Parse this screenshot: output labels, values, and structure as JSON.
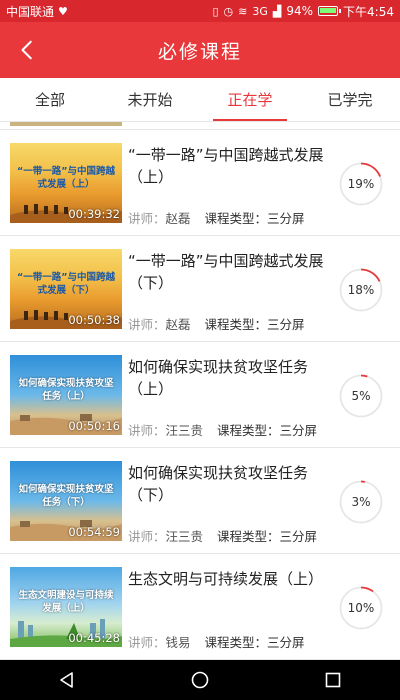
{
  "status_bar": {
    "carrier": "中国联通",
    "signal_label": "3G",
    "battery_text": "94%",
    "battery_level": 0.94,
    "time": "下午4:54"
  },
  "header": {
    "title": "必修课程"
  },
  "tabs": [
    {
      "label": "全部",
      "active": false
    },
    {
      "label": "未开始",
      "active": false
    },
    {
      "label": "正在学",
      "active": true
    },
    {
      "label": "已学完",
      "active": false
    }
  ],
  "labels": {
    "teacher_prefix": "讲师：",
    "type_prefix": "课程类型："
  },
  "courses": [
    {
      "title": "“一带一路”与中国跨越式发展（上）",
      "thumb_caption": "“一带一路”与中国跨越式发展（上）",
      "duration": "00:39:32",
      "teacher": "赵磊",
      "type": "三分屏",
      "progress": 19,
      "progress_text": "19%"
    },
    {
      "title": "“一带一路”与中国跨越式发展（下）",
      "thumb_caption": "“一带一路”与中国跨越式发展（下）",
      "duration": "00:50:38",
      "teacher": "赵磊",
      "type": "三分屏",
      "progress": 18,
      "progress_text": "18%"
    },
    {
      "title": "如何确保实现扶贫攻坚任务（上）",
      "thumb_caption": "如何确保实现扶贫攻坚任务（上）",
      "duration": "00:50:16",
      "teacher": "汪三贵",
      "type": "三分屏",
      "progress": 5,
      "progress_text": "5%"
    },
    {
      "title": "如何确保实现扶贫攻坚任务（下）",
      "thumb_caption": "如何确保实现扶贫攻坚任务（下）",
      "duration": "00:54:59",
      "teacher": "汪三贵",
      "type": "三分屏",
      "progress": 3,
      "progress_text": "3%"
    },
    {
      "title": "生态文明与可持续发展（上）",
      "thumb_caption": "生态文明建设与可持续发展（上）",
      "duration": "00:45:28",
      "teacher": "钱易",
      "type": "三分屏",
      "progress": 10,
      "progress_text": "10%"
    }
  ],
  "colors": {
    "accent": "#e8383c",
    "status_bar": "#d9272e",
    "progress_track": "#e6e6e6"
  },
  "icons": {
    "back": "back-arrow-icon",
    "nav_back": "nav-back-icon",
    "nav_home": "nav-home-icon",
    "nav_recent": "nav-recent-icon"
  }
}
